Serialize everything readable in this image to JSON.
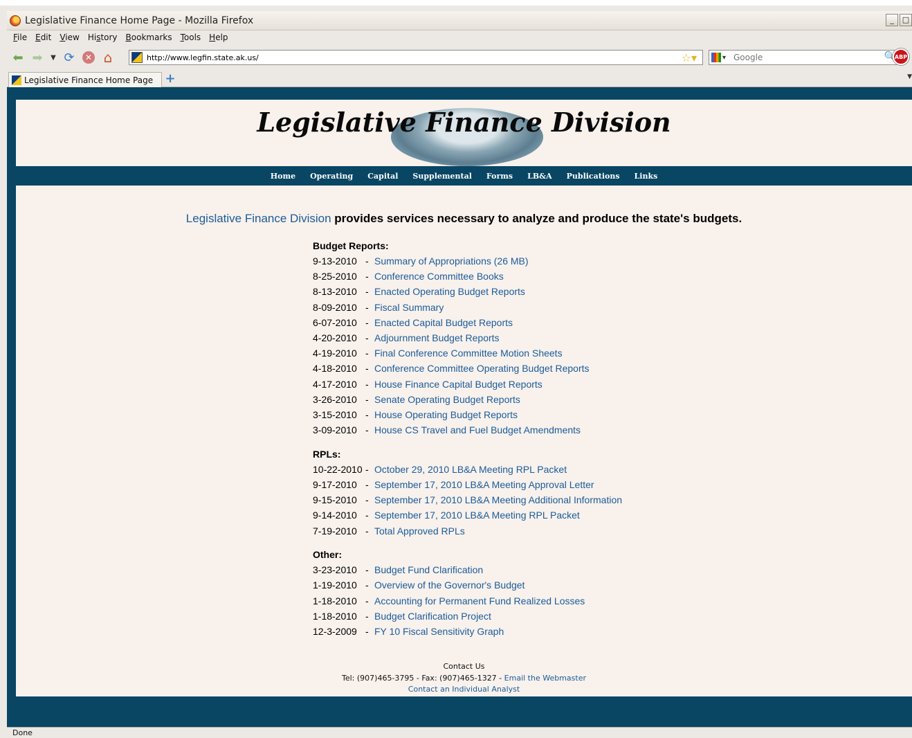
{
  "window": {
    "title": "Legislative Finance Home Page - Mozilla Firefox",
    "min_label": "_",
    "max_label": "□"
  },
  "menubar": [
    {
      "acc": "F",
      "rest": "ile"
    },
    {
      "acc": "E",
      "rest": "dit"
    },
    {
      "acc": "V",
      "rest": "iew"
    },
    {
      "pre": "Hi",
      "acc": "s",
      "rest": "tory"
    },
    {
      "acc": "B",
      "rest": "ookmarks"
    },
    {
      "acc": "T",
      "rest": "ools"
    },
    {
      "acc": "H",
      "rest": "elp"
    }
  ],
  "navbar": {
    "url": "http://www.legfin.state.ak.us/",
    "search_placeholder": "Google",
    "abp_label": "ABP"
  },
  "tabs": {
    "active_title": "Legislative Finance Home Page",
    "new_tab_label": "+"
  },
  "site": {
    "title": "Legislative Finance Division",
    "nav": [
      "Home",
      "Operating",
      "Capital",
      "Supplemental",
      "Forms",
      "LB&A",
      "Publications",
      "Links"
    ],
    "intro_link": "Legislative Finance Division",
    "intro_text": " provides services necessary to analyze and produce the state's budgets."
  },
  "sections": [
    {
      "heading": "Budget Reports:",
      "items": [
        {
          "date": "9-13-2010",
          "link": "Summary of Appropriations (26 MB)"
        },
        {
          "date": "8-25-2010",
          "link": "Conference Committee Books"
        },
        {
          "date": "8-13-2010",
          "link": "Enacted Operating Budget Reports"
        },
        {
          "date": "8-09-2010",
          "link": "Fiscal Summary"
        },
        {
          "date": "6-07-2010",
          "link": "Enacted Capital Budget Reports"
        },
        {
          "date": "4-20-2010",
          "link": "Adjournment Budget Reports"
        },
        {
          "date": "4-19-2010",
          "link": "Final Conference Committee Motion Sheets"
        },
        {
          "date": "4-18-2010",
          "link": "Conference Committee Operating Budget Reports"
        },
        {
          "date": "4-17-2010",
          "link": "House Finance Capital Budget Reports"
        },
        {
          "date": "3-26-2010",
          "link": "Senate Operating Budget Reports"
        },
        {
          "date": "3-15-2010",
          "link": "House Operating Budget Reports"
        },
        {
          "date": "3-09-2010",
          "link": "House CS Travel and Fuel Budget Amendments"
        }
      ]
    },
    {
      "heading": "RPLs:",
      "items": [
        {
          "date": "10-22-2010",
          "link": "October 29, 2010 LB&A Meeting RPL Packet"
        },
        {
          "date": "9-17-2010",
          "link": "September 17, 2010 LB&A Meeting Approval Letter"
        },
        {
          "date": "9-15-2010",
          "link": "September 17, 2010 LB&A Meeting Additional Information"
        },
        {
          "date": "9-14-2010",
          "link": "September 17, 2010 LB&A Meeting RPL Packet"
        },
        {
          "date": "7-19-2010",
          "link": "Total Approved RPLs"
        }
      ]
    },
    {
      "heading": "Other:",
      "items": [
        {
          "date": "3-23-2010",
          "link": "Budget Fund Clarification"
        },
        {
          "date": "1-19-2010",
          "link": "Overview of the Governor's Budget"
        },
        {
          "date": "1-18-2010",
          "link": "Accounting for Permanent Fund Realized Losses"
        },
        {
          "date": "1-18-2010",
          "link": "Budget Clarification Project"
        },
        {
          "date": "12-3-2009",
          "link": "FY 10 Fiscal Sensitivity Graph"
        }
      ]
    }
  ],
  "separator": "-",
  "contact": {
    "heading": "Contact Us",
    "phone_text": "Tel: (907)465-3795 - Fax: (907)465-1327 - ",
    "email_link": "Email the Webmaster",
    "analyst_link": "Contact an Individual Analyst"
  },
  "status": {
    "text": "Done"
  }
}
